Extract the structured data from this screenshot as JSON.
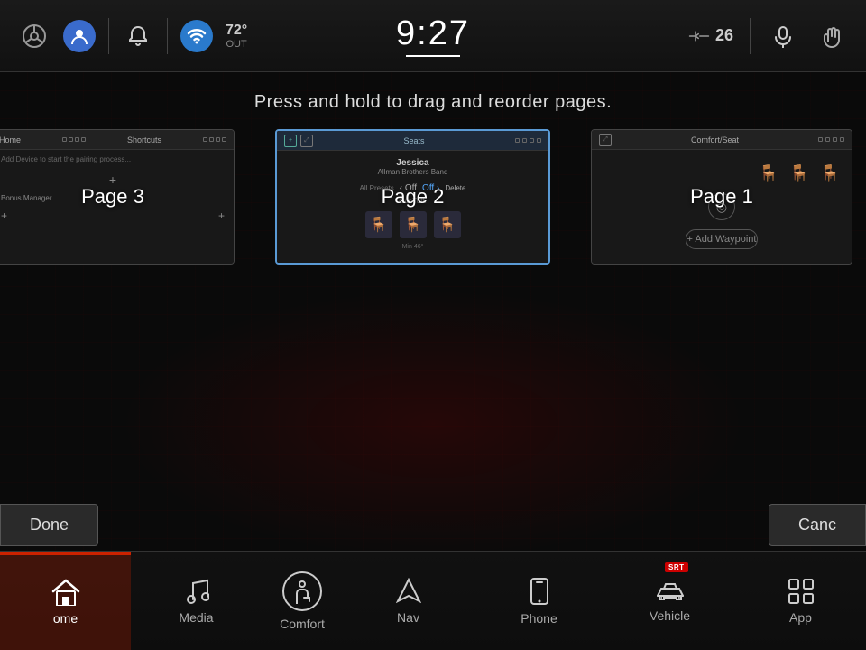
{
  "header": {
    "time": "9:27",
    "temperature": "72°",
    "temp_label": "OUT",
    "fan_speed": "26",
    "icons": {
      "steering": "⊕",
      "person": "👤",
      "bell": "🔔",
      "wifi": "📶",
      "mic": "🎤",
      "hand": "✋"
    }
  },
  "instruction": "Press and hold to drag and reorder pages.",
  "pages": [
    {
      "id": "page3",
      "label": "Page 3",
      "card_label": "Home",
      "order": 3
    },
    {
      "id": "page2",
      "label": "Page 2",
      "card_label": "Seats",
      "contact_name": "Jessica",
      "contact_sub": "Allman Brothers Band",
      "order": 2
    },
    {
      "id": "page1",
      "label": "Page 1",
      "card_label": "Comfort/Seat",
      "order": 1
    }
  ],
  "buttons": {
    "done": "Done",
    "cancel": "Canc"
  },
  "nav": {
    "items": [
      {
        "id": "home",
        "label": "ome",
        "icon": "home",
        "active": true
      },
      {
        "id": "media",
        "label": "Media",
        "icon": "music",
        "active": false
      },
      {
        "id": "comfort",
        "label": "Comfort",
        "icon": "person-seat",
        "active": false
      },
      {
        "id": "nav",
        "label": "Nav",
        "icon": "navigate",
        "active": false
      },
      {
        "id": "phone",
        "label": "Phone",
        "icon": "phone",
        "active": false
      },
      {
        "id": "vehicle",
        "label": "Vehicle",
        "icon": "car",
        "active": false,
        "badge": "SRT"
      },
      {
        "id": "apps",
        "label": "App",
        "icon": "grid",
        "active": false
      }
    ]
  }
}
